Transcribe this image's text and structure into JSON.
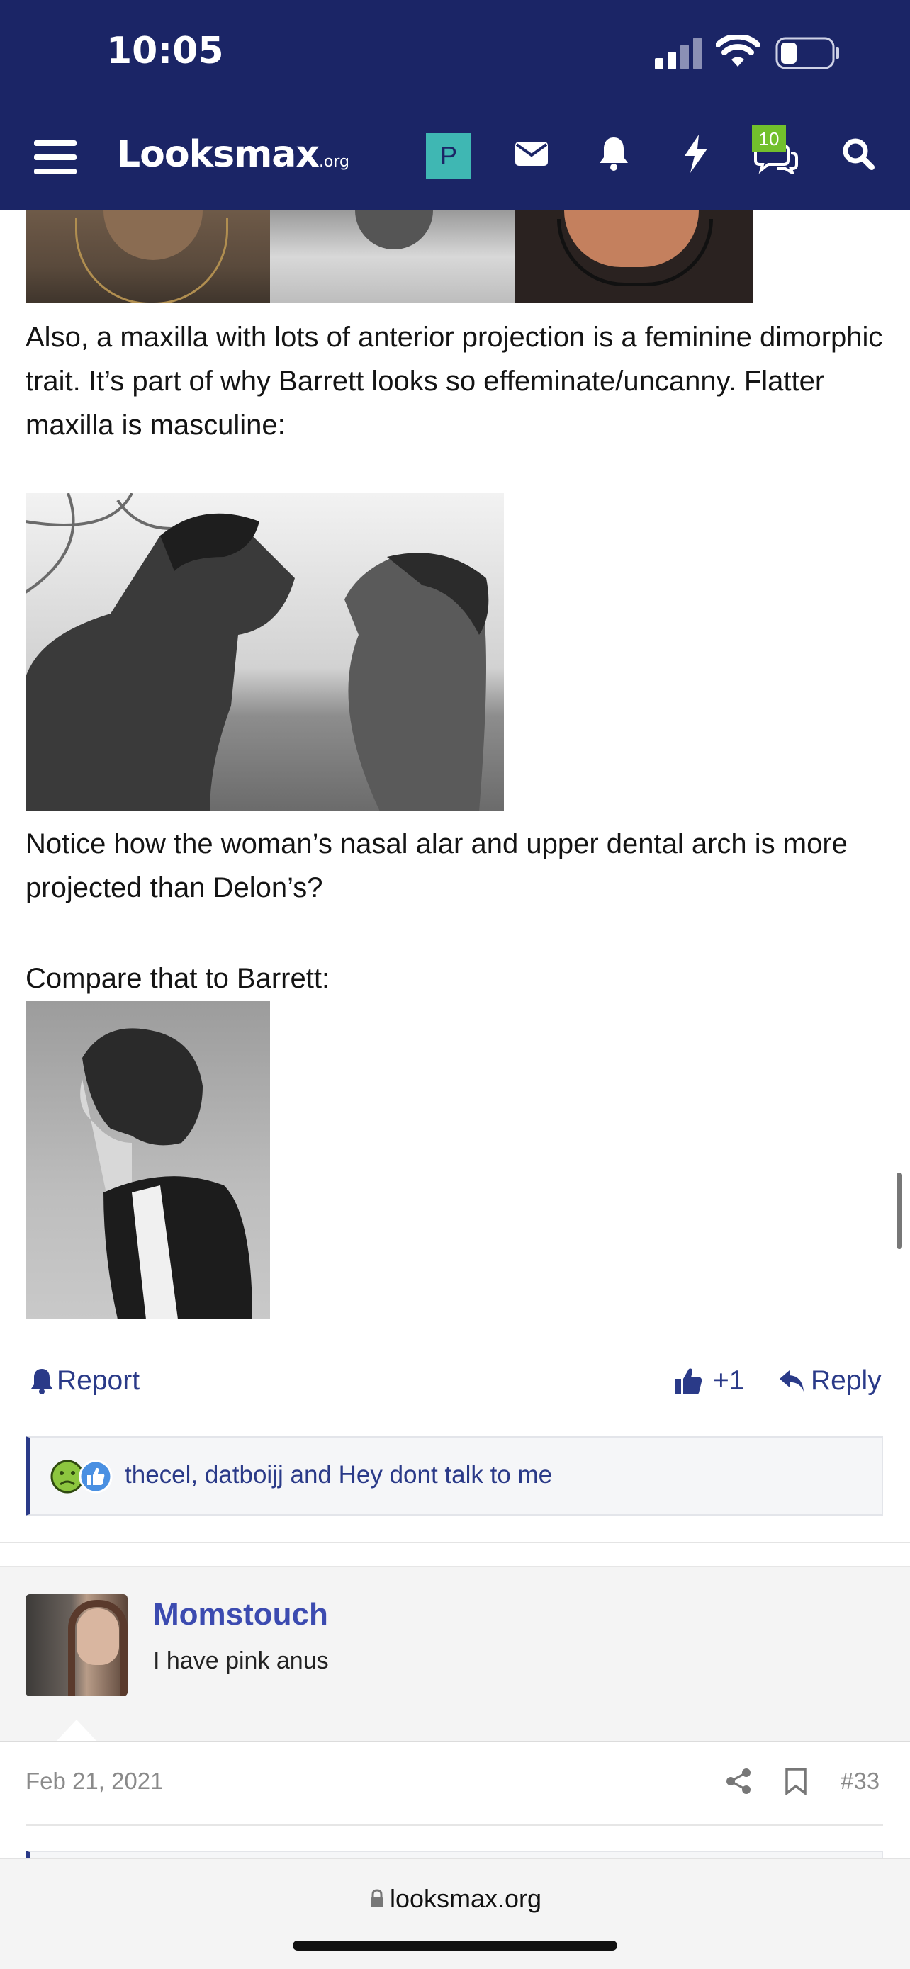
{
  "status_bar": {
    "time": "10:05"
  },
  "nav": {
    "logo_main": "Looksmax",
    "logo_suffix": ".org",
    "user_initial": "P",
    "conversations_count": "10"
  },
  "post": {
    "paragraph1": "Also, a maxilla with lots of anterior projection is a feminine dimorphic trait. It’s part of why Barrett looks so effeminate/uncanny. Flatter maxilla is masculine:",
    "paragraph2": "Notice how the woman’s nasal alar and upper dental arch is more projected than Delon’s?",
    "paragraph3": "Compare that to Barrett:",
    "actions": {
      "report": "Report",
      "like_count": "+1",
      "reply": "Reply"
    },
    "reactions_text": "thecel, datboijj and Hey dont talk to me"
  },
  "next_post": {
    "username": "Momstouch",
    "user_title": "I have pink anus",
    "date": "Feb 21, 2021",
    "number": "#33"
  },
  "browser": {
    "url": "looksmax.org"
  },
  "colors": {
    "nav_bg": "#1b2566",
    "link": "#2a3a88",
    "username": "#3c4bb0",
    "badge": "#72c02c",
    "avatar_p": "#3fb7b3"
  }
}
